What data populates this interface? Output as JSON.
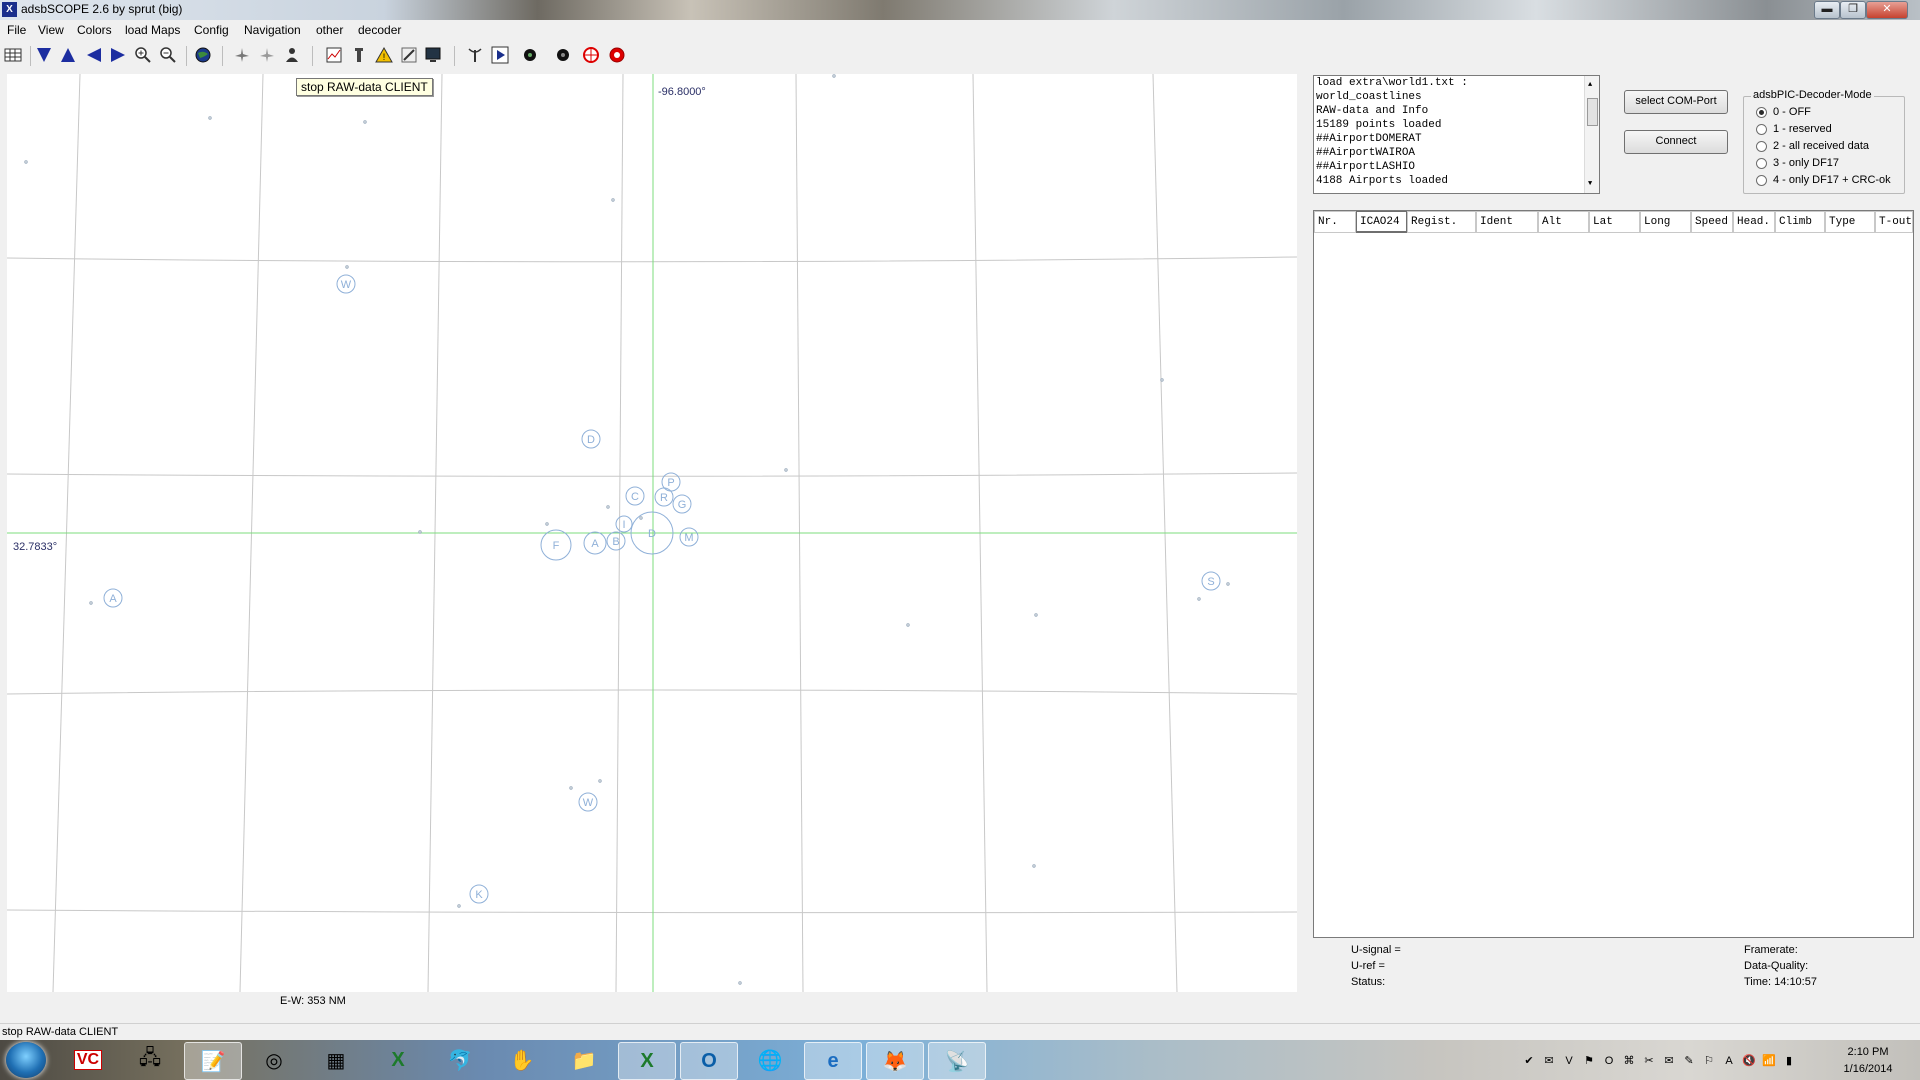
{
  "window": {
    "title": "adsbSCOPE 2.6 by sprut  (big)",
    "minimize": "▬",
    "maximize": "❐",
    "close": "✕"
  },
  "menu": [
    "File",
    "View",
    "Colors",
    "load Maps",
    "Config",
    "Navigation",
    "other",
    "decoder"
  ],
  "toolbar": {
    "tooltip": "stop RAW-data CLIENT",
    "icons": [
      "table-icon",
      "arrow-down-icon",
      "arrow-up-icon",
      "arrow-left-icon",
      "arrow-right-icon",
      "zoom-in-icon",
      "zoom-out-icon",
      "globe-icon",
      "aircraft-group-icon",
      "aircraft-group-2-icon",
      "aircraft-user-icon",
      "chart-icon",
      "tower-icon",
      "warning-icon",
      "edit-icon",
      "monitor-icon",
      "antenna-icon",
      "play-icon",
      "record-black-icon",
      "record-black-2-icon",
      "target-red-icon",
      "target-red-2-icon"
    ]
  },
  "map": {
    "lon_label": "-96.8000°",
    "lat_label": "32.7833°",
    "ew_label": "E-W: 353 NM",
    "airport_letters": [
      "W",
      "D",
      "P",
      "C",
      "R",
      "G",
      "I",
      "F",
      "A",
      "B",
      "M",
      "A",
      "S",
      "W",
      "K"
    ]
  },
  "log": {
    "lines": [
      "load extra\\world1.txt :",
      "world_coastlines",
      "RAW-data and Info",
      "15189 points loaded",
      "##AirportDOMERAT",
      "##AirportWAIROA",
      "##AirportLASHIO",
      "4188 Airports loaded"
    ]
  },
  "buttons": {
    "select_com": "select COM-Port",
    "connect": "Connect"
  },
  "decoder_mode": {
    "legend": "adsbPIC-Decoder-Mode",
    "options": [
      "0 - OFF",
      "1 - reserved",
      "2 - all received data",
      "3 - only DF17",
      "4 - only DF17 + CRC-ok"
    ],
    "selected_index": 0
  },
  "table": {
    "columns": [
      "Nr.",
      "ICAO24",
      "Regist.",
      "Ident",
      "Alt",
      "Lat",
      "Long",
      "Speed",
      "Head.",
      "Climb",
      "Type",
      "T-out"
    ],
    "active_column": "ICAO24",
    "rows": []
  },
  "status_panel": {
    "u_signal": "U-signal =",
    "u_ref": "U-ref =",
    "status": "Status:",
    "framerate": "Framerate:",
    "data_quality": "Data-Quality:",
    "time": "Time: 14:10:57"
  },
  "status_bar": {
    "text": "stop RAW-data CLIENT"
  },
  "taskbar": {
    "apps": [
      "start-orb",
      "vc-app-icon",
      "network-app-icon",
      "notepad-icon",
      "media-player-icon",
      "calculator-icon",
      "excel-icon",
      "dolphin-icon",
      "scanner-icon",
      "explorer-folder-icon",
      "excel-2-icon",
      "outlook-icon",
      "globe-app-icon",
      "ie-icon",
      "firefox-icon",
      "adsbscope-icon"
    ],
    "time": "2:10 PM",
    "date": "1/16/2014"
  }
}
